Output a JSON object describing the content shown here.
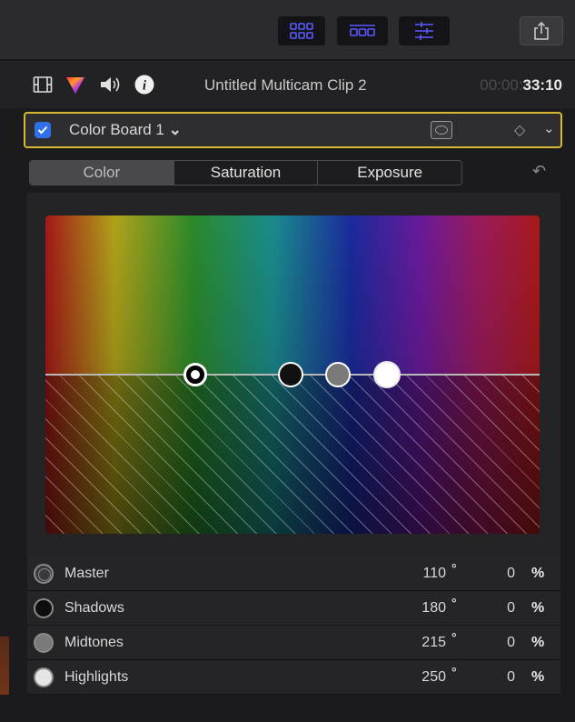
{
  "toolbar": {
    "buttons": [
      "libraries-grid-icon",
      "browser-filmstrip-icon",
      "inspector-sliders-icon",
      "share-icon"
    ]
  },
  "inspector": {
    "clip_title": "Untitled Multicam Clip 2",
    "timecode_dim": "00:00:",
    "timecode_bright": "33:10"
  },
  "color_board": {
    "enabled": true,
    "name": "Color Board 1",
    "name_chevron": "⌄",
    "keyframe_symbol": "◇",
    "menu_chevron": "⌄"
  },
  "tabs": [
    {
      "label": "Color",
      "active": true
    },
    {
      "label": "Saturation",
      "active": false
    },
    {
      "label": "Exposure",
      "active": false
    }
  ],
  "undo_symbol": "↶",
  "rows": [
    {
      "label": "Master",
      "angle": "110",
      "deg": "°",
      "percent": "0",
      "unit": "%"
    },
    {
      "label": "Shadows",
      "angle": "180",
      "deg": "°",
      "percent": "0",
      "unit": "%"
    },
    {
      "label": "Midtones",
      "angle": "215",
      "deg": "°",
      "percent": "0",
      "unit": "%"
    },
    {
      "label": "Highlights",
      "angle": "250",
      "deg": "°",
      "percent": "0",
      "unit": "%"
    }
  ],
  "colors": {
    "accent_blue": "#2f6fe8",
    "selection_yellow": "#d9b730",
    "toolbar_icon_blue": "#5a5aff"
  }
}
